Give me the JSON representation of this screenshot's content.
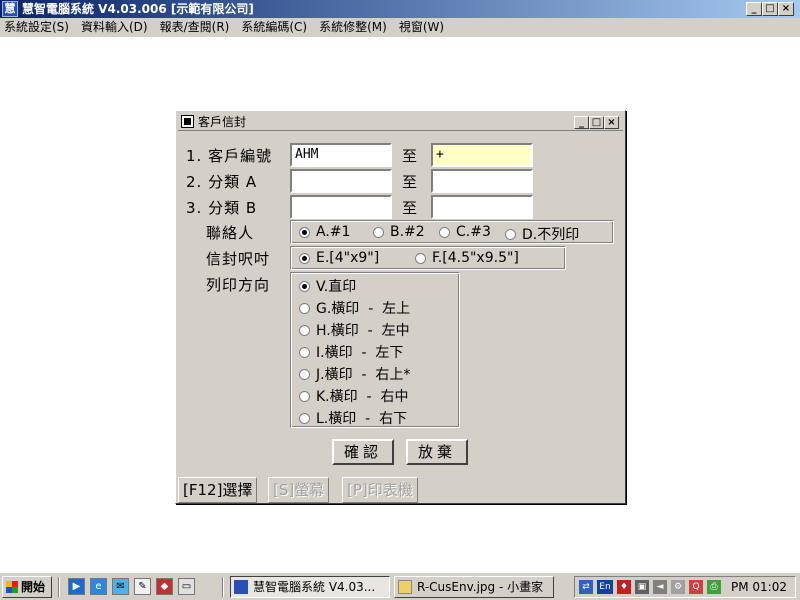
{
  "app": {
    "title": "慧智電腦系統 V4.03.006 [示範有限公司]",
    "icon": "app-logo-icon"
  },
  "menubar": [
    "系統設定(S)",
    "資料輸入(D)",
    "報表/查閱(R)",
    "系統編碼(C)",
    "系統修整(M)",
    "視窗(W)"
  ],
  "dialog": {
    "title": "客戶信封",
    "rows": [
      {
        "num": "1.",
        "label": "客戶編號",
        "from": "AHM",
        "to_label": "至",
        "to": "+"
      },
      {
        "num": "2.",
        "label": "分類 A",
        "from": "",
        "to_label": "至",
        "to": ""
      },
      {
        "num": "3.",
        "label": "分類 B",
        "from": "",
        "to_label": "至",
        "to": ""
      }
    ],
    "contact": {
      "label": "聯絡人",
      "options": [
        "A.#1",
        "B.#2",
        "C.#3",
        "D.不列印"
      ],
      "selected": "A.#1"
    },
    "envelope": {
      "label": "信封呎吋",
      "options": [
        "E.[4\"x9\"]",
        "F.[4.5\"x9.5\"]"
      ],
      "selected": "E.[4\"x9\"]"
    },
    "orientation": {
      "label": "列印方向",
      "options": [
        "V.直印",
        "G.橫印  -  左上",
        "H.橫印  -  左中",
        "I.橫印  -  左下",
        "J.橫印  -  右上*",
        "K.橫印  -  右中",
        "L.橫印  -  右下"
      ],
      "selected": "V.直印"
    },
    "confirm_label": "確認",
    "cancel_label": "放棄",
    "fkeys": [
      "[F12]選擇",
      "[S]螢幕",
      "[P]印表機"
    ]
  },
  "taskbar": {
    "start_label": "開始",
    "tasks": [
      "慧智電腦系統 V4.03...",
      "R-CusEnv.jpg - 小畫家"
    ],
    "tray_lang": "En",
    "clock": "PM 01:02"
  }
}
